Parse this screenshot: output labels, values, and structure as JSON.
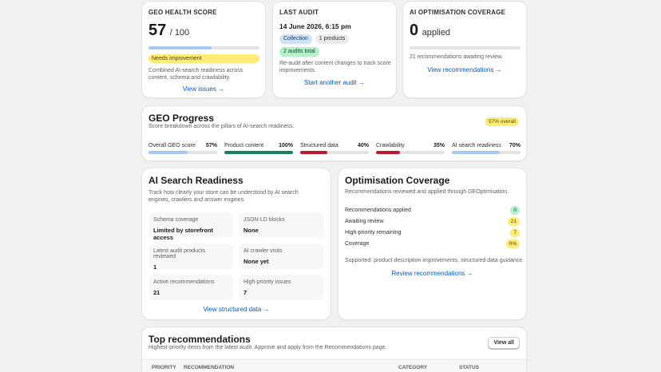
{
  "health": {
    "label": "GEO HEALTH SCORE",
    "score": "57",
    "max": "/ 100",
    "progress": 0.57,
    "badge": "Needs improvement",
    "desc": "Combined AI-search readiness across content, schema and crawlability.",
    "link": "View issues →"
  },
  "audit": {
    "label": "LAST AUDIT",
    "date": "14 June 2026, 6:15 pm",
    "tag1": "Collection",
    "tag2": "1 products",
    "tag3": "2 audits total",
    "desc": "Re-audit after content changes to track score improvements.",
    "link": "Start another audit →"
  },
  "coverage_card": {
    "label": "AI OPTIMISATION COVERAGE",
    "value": "0",
    "unit": "applied",
    "progress": 0,
    "desc": "21 recommendations awaiting review.",
    "link": "View recommendations →"
  },
  "progress": {
    "title": "GEO Progress",
    "subtitle": "Score breakdown across the pillars of AI-search readiness.",
    "overall_badge": "57% overall",
    "pillars": [
      {
        "name": "Overall GEO score",
        "value": "57%",
        "fraction": 0.57,
        "color": "#a4c8ef"
      },
      {
        "name": "Product content",
        "value": "100%",
        "fraction": 1.0,
        "color": "#1a7f5a"
      },
      {
        "name": "Structured data",
        "value": "40%",
        "fraction": 0.4,
        "color": "#c0172f"
      },
      {
        "name": "Crawlability",
        "value": "35%",
        "fraction": 0.35,
        "color": "#c0172f"
      },
      {
        "name": "AI search readiness",
        "value": "70%",
        "fraction": 0.7,
        "color": "#a4c8ef"
      }
    ]
  },
  "readiness": {
    "title": "AI Search Readiness",
    "subtitle": "Track how clearly your store can be understood by AI search engines, crawlers and answer engines.",
    "tiles": [
      {
        "title": "Schema coverage",
        "value": "Limited by storefront access"
      },
      {
        "title": "JSON-LD blocks",
        "value": "None"
      },
      {
        "title": "Latest audit products reviewed",
        "value": "1"
      },
      {
        "title": "AI crawler visits",
        "value": "None yet"
      },
      {
        "title": "Active recommendations",
        "value": "21"
      },
      {
        "title": "High-priority issues",
        "value": "7"
      }
    ],
    "link": "View structured data →"
  },
  "optimisation": {
    "title": "Optimisation Coverage",
    "subtitle": "Recommendations reviewed and applied through GEOptimisation.",
    "rows": [
      {
        "label": "Recommendations applied",
        "value": "0",
        "bg": "#b4f0c8",
        "fg": "#0c5132"
      },
      {
        "label": "Awaiting review",
        "value": "21",
        "bg": "#ffeb78",
        "fg": "#4f4700"
      },
      {
        "label": "High-priority remaining",
        "value": "7",
        "bg": "#ffeb78",
        "fg": "#4f4700"
      },
      {
        "label": "Coverage",
        "value": "0%",
        "bg": "#ffeb78",
        "fg": "#4f4700"
      }
    ],
    "supported": "Supported: product description improvements, structured data guidance.",
    "link": "Review recommendations →"
  },
  "top": {
    "title": "Top recommendations",
    "subtitle": "Highest-priority items from the latest audit. Approve and apply from the Recommendations page.",
    "button": "View all",
    "columns": [
      "PRIORITY",
      "RECOMMENDATION",
      "CATEGORY",
      "STATUS"
    ]
  }
}
